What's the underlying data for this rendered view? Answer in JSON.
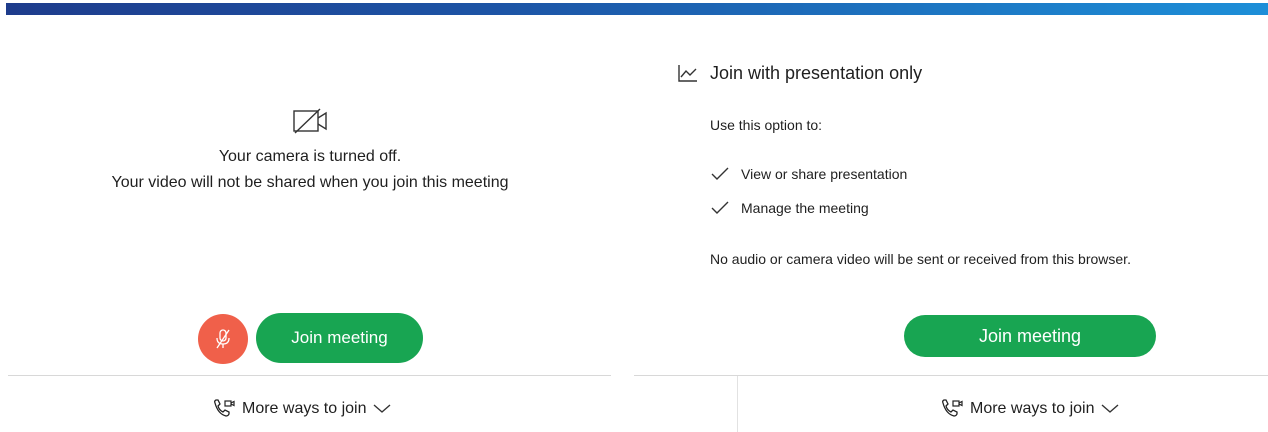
{
  "left": {
    "camera_off_line1": "Your camera is turned off.",
    "camera_off_line2": "Your video will not be shared when you join this meeting",
    "join_label": "Join meeting",
    "more_ways_label": "More ways to join"
  },
  "right": {
    "title": "Join with presentation only",
    "use_option": "Use this option to:",
    "options": [
      "View or share presentation",
      "Manage the meeting"
    ],
    "note": "No audio or camera video will be sent or received from this browser.",
    "join_label": "Join meeting",
    "more_ways_label": "More ways to join"
  },
  "colors": {
    "join_green": "#18a552",
    "mute_red": "#f0604a",
    "header_gradient_start": "#1e3c8c",
    "header_gradient_end": "#1d8fd8"
  },
  "icons": [
    "camera-off-icon",
    "microphone-muted-icon",
    "phone-video-icon",
    "chevron-down-icon",
    "chart-line-icon",
    "checkmark-icon"
  ]
}
